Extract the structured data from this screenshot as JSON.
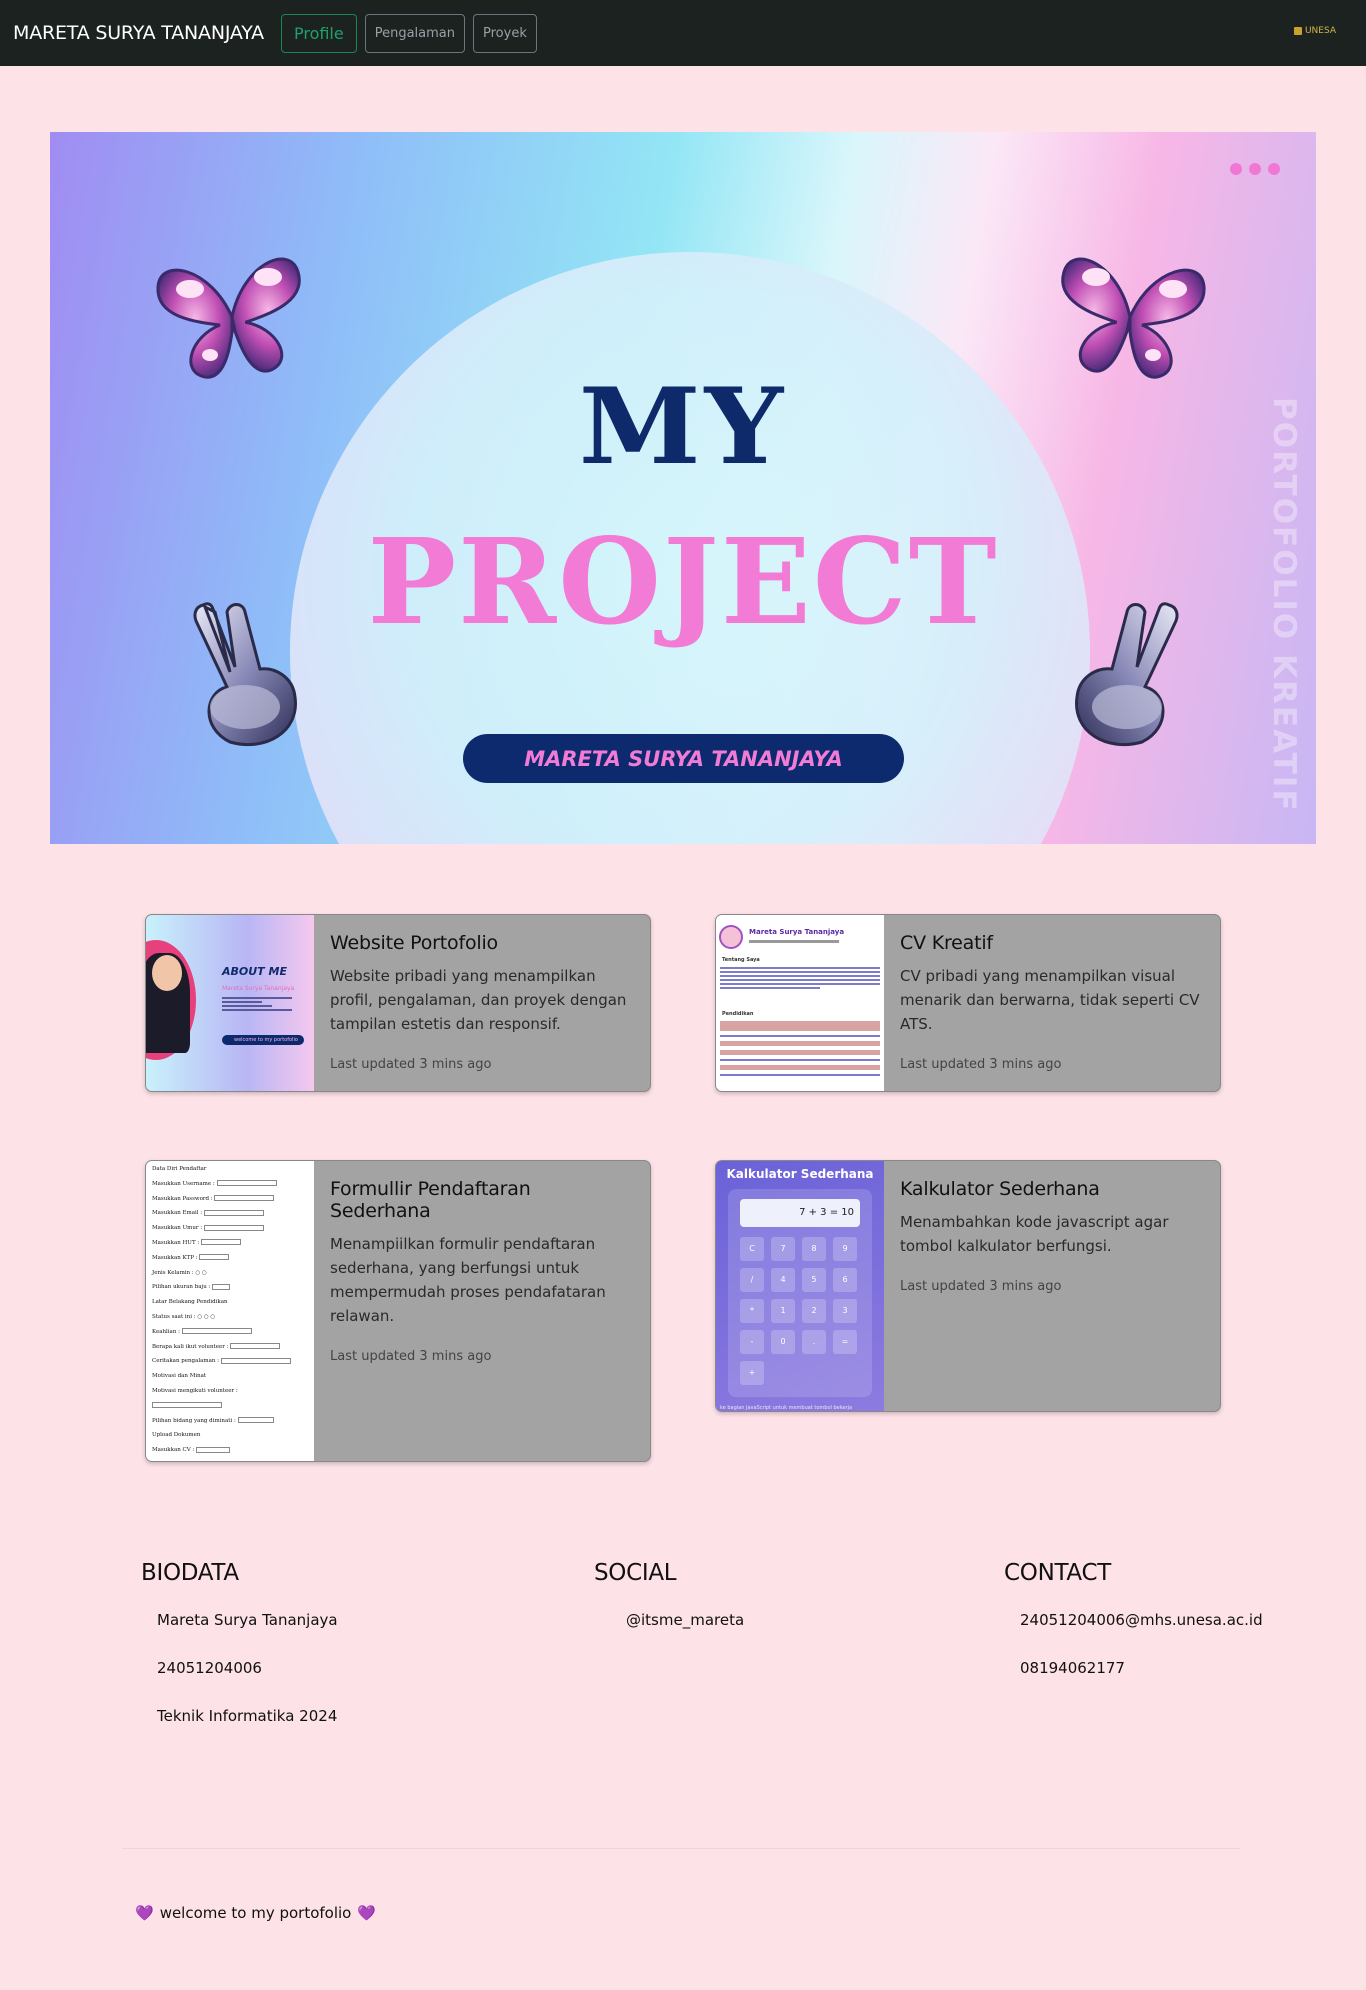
{
  "navbar": {
    "brand": "MARETA SURYA TANANJAYA",
    "links": [
      "Profile",
      "Pengalaman",
      "Proyek"
    ],
    "logo_text": "UNESA"
  },
  "hero": {
    "title_line1": "MY",
    "title_line2": "PROJECT",
    "name": "MARETA SURYA TANANJAYA",
    "side_text": "PORTOFOLIO KREATIF"
  },
  "cards": [
    {
      "title": "Website Portofolio",
      "description": "Website pribadi yang menampilkan profil, pengalaman, dan proyek dengan tampilan estetis dan responsif.",
      "updated": "Last updated 3 mins ago",
      "thumb": {
        "heading": "ABOUT ME",
        "name": "Mareta Surya Tananjaya",
        "button": "welcome to my portofolio"
      }
    },
    {
      "title": "CV Kreatif",
      "description": "CV pribadi yang menampilkan visual menarik dan berwarna, tidak seperti CV ATS.",
      "updated": "Last updated 3 mins ago",
      "thumb": {
        "name": "Mareta Surya Tananjaya",
        "section1": "Tentang Saya",
        "section2": "Pendidikan"
      }
    },
    {
      "title": "Formullir Pendaftaran Sederhana",
      "description": "Menampiilkan formulir pendaftaran sederhana, yang berfungsi untuk mempermudah proses pendafataran relawan.",
      "updated": "Last updated 3 mins ago",
      "thumb": {
        "labels": [
          "Data Diri Pendaftar",
          "Masukkan Username :",
          "Masukkan Password :",
          "Masukkan Email :",
          "Masukkan Umur :",
          "Masukkan HUT :",
          "Masukkan KTP :",
          "Jenis Kelamin :",
          "Pilihan ukuran baju :",
          "Latar Belakang Pendidikan",
          "Status saat ini :",
          "Keahlian :",
          "Berapa kali ikut volunteer :",
          "Ceritakan pengalaman :",
          "Motivasi dan Minat",
          "Motivasi mengikuti volunteer :",
          "Pilihan bidang yang diminati :",
          "Upload Dokumen",
          "Masukkan CV :"
        ]
      }
    },
    {
      "title": "Kalkulator Sederhana",
      "description": "Menambahkan kode javascript agar tombol kalkulator berfungsi.",
      "updated": "Last updated 3 mins ago",
      "thumb": {
        "heading": "Kalkulator Sederhana",
        "display": "7 + 3 = 10",
        "keys": [
          "C",
          "7",
          "8",
          "9",
          "/",
          "4",
          "5",
          "6",
          "*",
          "1",
          "2",
          "3",
          "-",
          "0",
          ".",
          "=",
          "+"
        ],
        "caption": "ke bagian JavaScript untuk membuat tombol bekerja"
      }
    }
  ],
  "footer": {
    "biodata": {
      "heading": "BIODATA",
      "items": [
        "Mareta Surya Tananjaya",
        "24051204006",
        "Teknik Informatika 2024"
      ]
    },
    "social": {
      "heading": "SOCIAL",
      "items": [
        "@itsme_mareta"
      ]
    },
    "contact": {
      "heading": "CONTACT",
      "items": [
        "24051204006@mhs.unesa.ac.id",
        "08194062177"
      ]
    },
    "welcome": "welcome to my portofolio"
  },
  "colors": {
    "navbar": "#1b2220",
    "page_bg": "#fde2e8",
    "card_bg": "#a3a3a3",
    "accent_pink": "#f27bd6",
    "navy": "#0f2a6b",
    "active_link": "#198754"
  }
}
